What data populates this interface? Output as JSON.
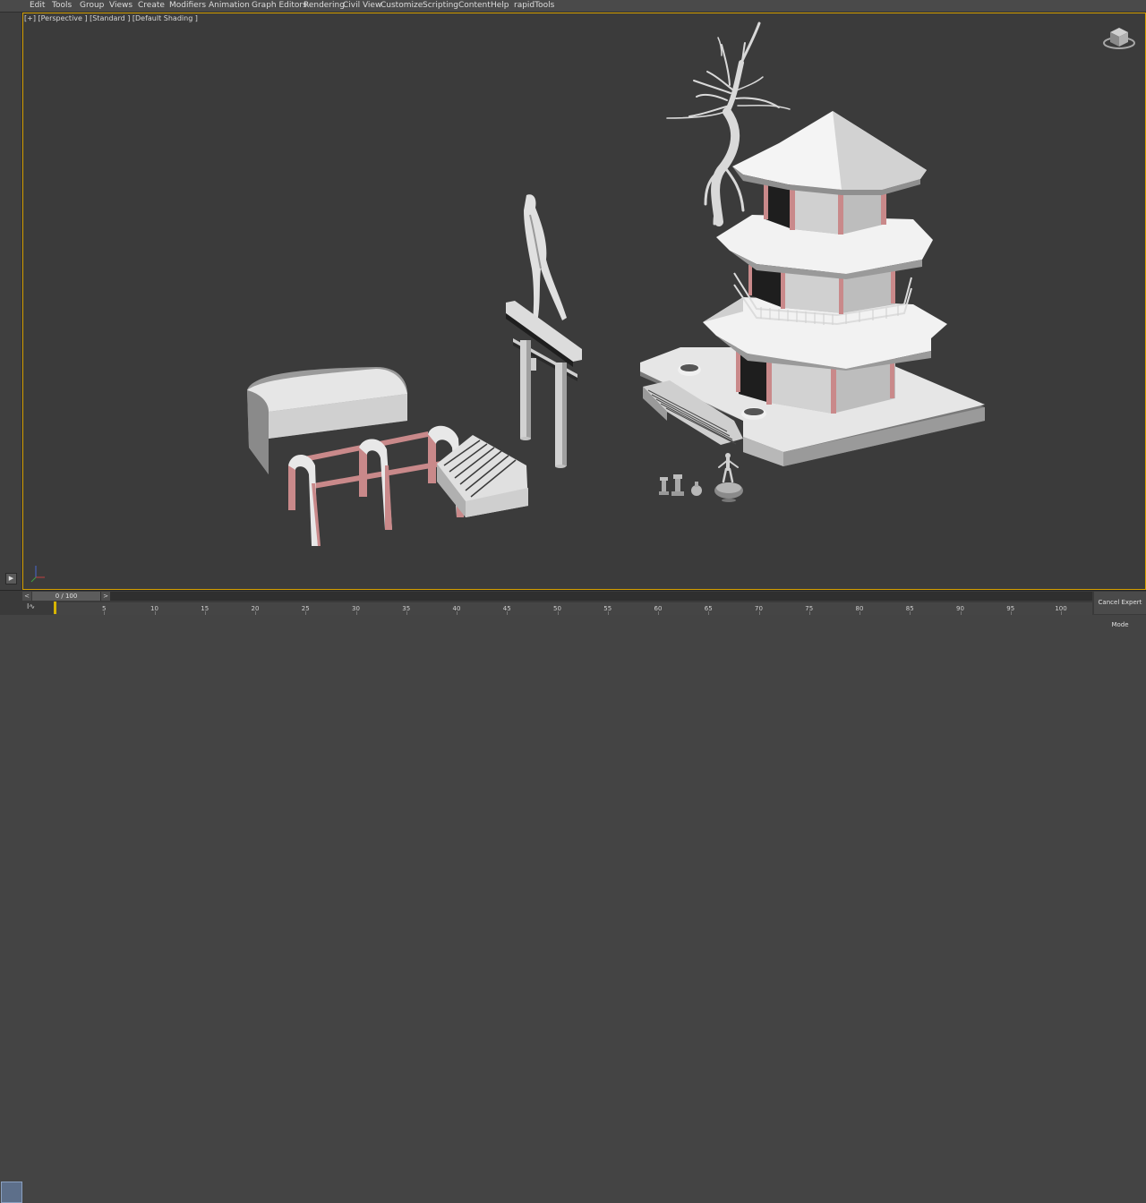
{
  "menubar": {
    "items": [
      "Edit",
      "Tools",
      "Group",
      "Views",
      "Create",
      "Modifiers",
      "Animation",
      "Graph Editors",
      "Rendering",
      "Civil View",
      "Customize",
      "Scripting",
      "Content",
      "Help",
      "rapidTools"
    ]
  },
  "viewport": {
    "label": "[+] [Perspective ] [Standard ] [Default Shading ]",
    "active_border_color": "#d6a000",
    "background_color": "#3b3b3b"
  },
  "timeline": {
    "frame_display": "0 / 100",
    "current_frame": 0,
    "prev_arrow": "<",
    "next_arrow": ">",
    "ticks": [
      5,
      10,
      15,
      20,
      25,
      30,
      35,
      40,
      45,
      50,
      55,
      60,
      65,
      70,
      75,
      80,
      85,
      90,
      95,
      100
    ],
    "curve_editor_label": "Ι∿",
    "cancel_expert_label": "Cancel Expert Mode"
  },
  "icons": {
    "viewcube": "viewcube-icon",
    "axis": "axis-tripod-icon",
    "play": "play-icon"
  },
  "colors": {
    "accent_pink": "#c9898a",
    "model_white": "#e6e6e6",
    "timeline_cursor": "#d6b400"
  }
}
